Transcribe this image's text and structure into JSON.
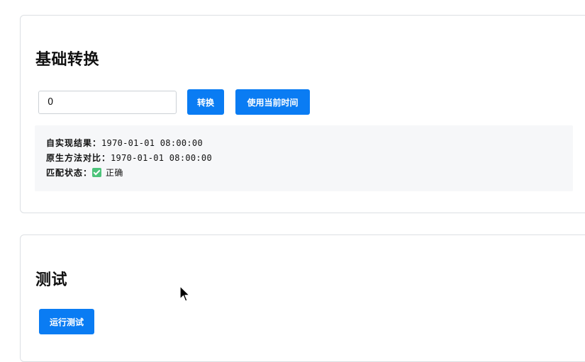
{
  "basic": {
    "title": "基础转换",
    "input_value": "0",
    "convert_label": "转换",
    "now_label": "使用当前时间",
    "results": {
      "custom_label": "自实现结果：",
      "custom_value": "1970-01-01 08:00:00",
      "native_label": "原生方法对比：",
      "native_value": "1970-01-01 08:00:00",
      "match_label": "匹配状态：",
      "match_icon": "check-icon",
      "match_value": "正确"
    }
  },
  "test": {
    "title": "测试",
    "run_label": "运行测试"
  },
  "colors": {
    "accent": "#0a7cf3",
    "success": "#4cc37a",
    "result_bg": "#f6f7f9"
  }
}
